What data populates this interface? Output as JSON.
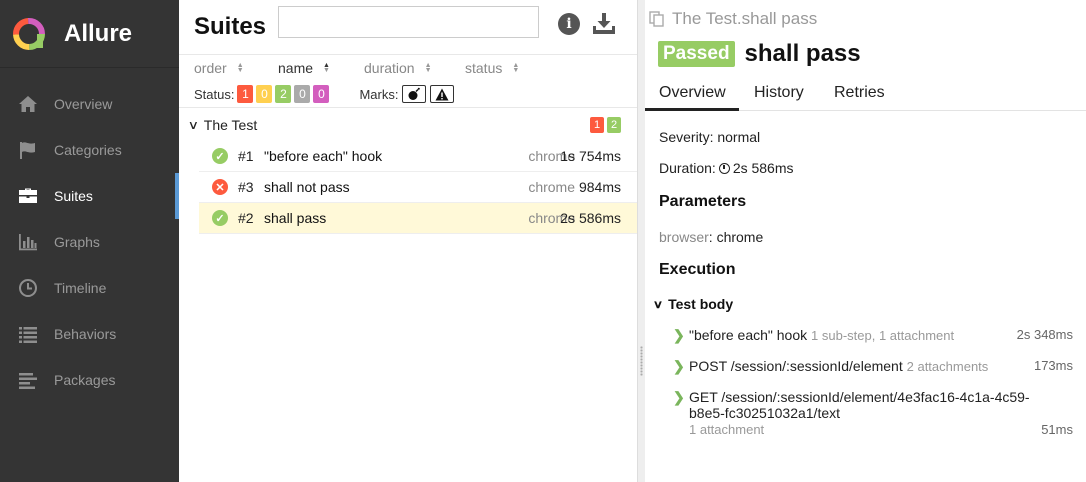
{
  "sidebar": {
    "brand": "Allure",
    "items": [
      {
        "label": "Overview",
        "icon": "home-icon"
      },
      {
        "label": "Categories",
        "icon": "flag-icon"
      },
      {
        "label": "Suites",
        "icon": "briefcase-icon",
        "active": true
      },
      {
        "label": "Graphs",
        "icon": "bar-chart-icon"
      },
      {
        "label": "Timeline",
        "icon": "clock-icon"
      },
      {
        "label": "Behaviors",
        "icon": "list-icon"
      },
      {
        "label": "Packages",
        "icon": "align-left-icon"
      }
    ]
  },
  "suites": {
    "title": "Suites",
    "search_value": "",
    "sorters": [
      "order",
      "name",
      "duration",
      "status"
    ],
    "status_label": "Status:",
    "status_counts": {
      "failed": "1",
      "broken": "0",
      "passed": "2",
      "skipped": "0",
      "unknown": "0"
    },
    "marks_label": "Marks:",
    "group": {
      "name": "The Test",
      "failed": "1",
      "passed": "2"
    },
    "tests": [
      {
        "num": "#1",
        "name": "\"before each\" hook",
        "env": "chrome",
        "duration": "1s 754ms",
        "status": "passed"
      },
      {
        "num": "#3",
        "name": "shall not pass",
        "env": "chrome",
        "duration": "984ms",
        "status": "failed"
      },
      {
        "num": "#2",
        "name": "shall pass",
        "env": "chrome",
        "duration": "2s 586ms",
        "status": "passed",
        "selected": true
      }
    ]
  },
  "detail": {
    "breadcrumb": "The Test.shall pass",
    "status_badge": "Passed",
    "title": "shall pass",
    "tabs": [
      "Overview",
      "History",
      "Retries"
    ],
    "severity": "Severity: normal",
    "duration_label": "Duration:",
    "duration_value": "2s 586ms",
    "parameters_title": "Parameters",
    "param_key": "browser",
    "param_value": ": chrome",
    "execution_title": "Execution",
    "test_body_label": "Test body",
    "steps": [
      {
        "name": "\"before each\" hook",
        "meta": "1 sub-step, 1 attachment",
        "duration": "2s 348ms"
      },
      {
        "name": "POST /session/:sessionId/element",
        "meta": "2 attachments",
        "duration": "173ms"
      },
      {
        "name": "GET /session/:sessionId/element/4e3fac16-4c1a-4c59-b8e5-fc30251032a1/text",
        "meta": "1 attachment",
        "duration": "51ms"
      }
    ]
  },
  "colors": {
    "sidebar_bg": "#343434",
    "accent": "#5b9ad5",
    "passed": "#97cc64",
    "failed": "#fd5a3e",
    "broken": "#ffd050",
    "skipped": "#aaaaaa",
    "unknown": "#d35ebe",
    "selected_row": "#fff9d8"
  }
}
